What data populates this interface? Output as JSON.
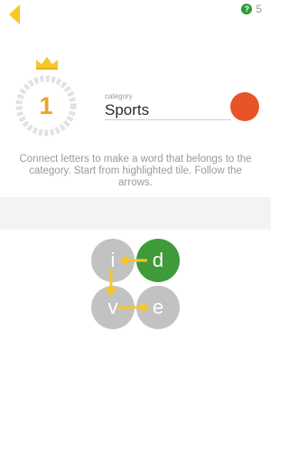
{
  "header": {
    "hint_count": "5",
    "hint_icon": "?"
  },
  "level": {
    "number": "1"
  },
  "category": {
    "label": "category",
    "value": "Sports",
    "color": "#e8542a"
  },
  "instructions": "Connect letters to make a word that belongs to the category. Start from highlighted tile. Follow the arrows.",
  "tiles": [
    {
      "letter": "i"
    },
    {
      "letter": "d"
    },
    {
      "letter": "v"
    },
    {
      "letter": "e"
    }
  ],
  "colors": {
    "accent": "#f0c020",
    "active_tile": "#3f9a3a",
    "tile": "#c2c2c2",
    "level": "#f0a228"
  }
}
